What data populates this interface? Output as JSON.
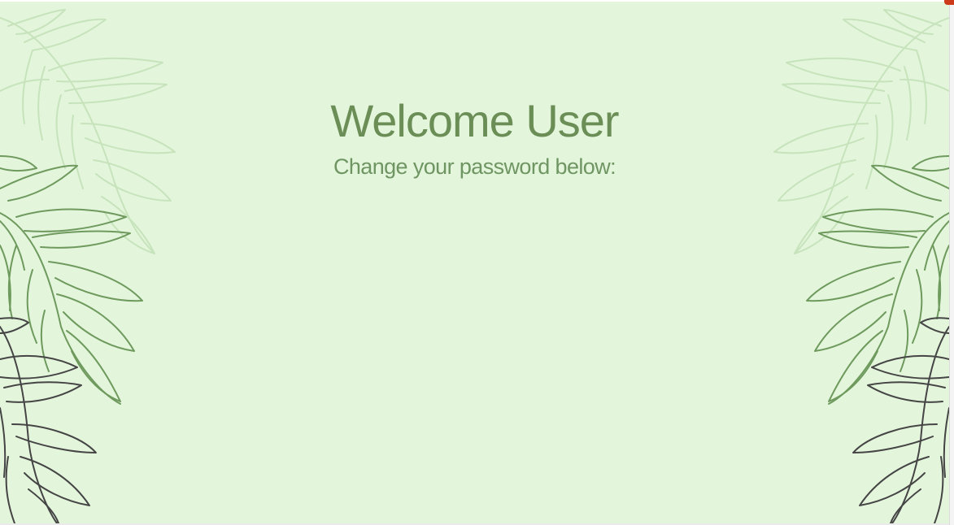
{
  "page": {
    "title": "Welcome User",
    "subtitle": "Change your password below:"
  },
  "colors": {
    "background": "#e3f5db",
    "title": "#6b8e56",
    "leaf_light": "#c7e3bc",
    "leaf_mid": "#6f9a5e",
    "leaf_dark": "#3f3f3f",
    "corner_badge": "#cc3a1a"
  },
  "decorations": {
    "left_fern_icon": "fern-leaves-icon",
    "right_fern_icon": "fern-leaves-icon"
  }
}
